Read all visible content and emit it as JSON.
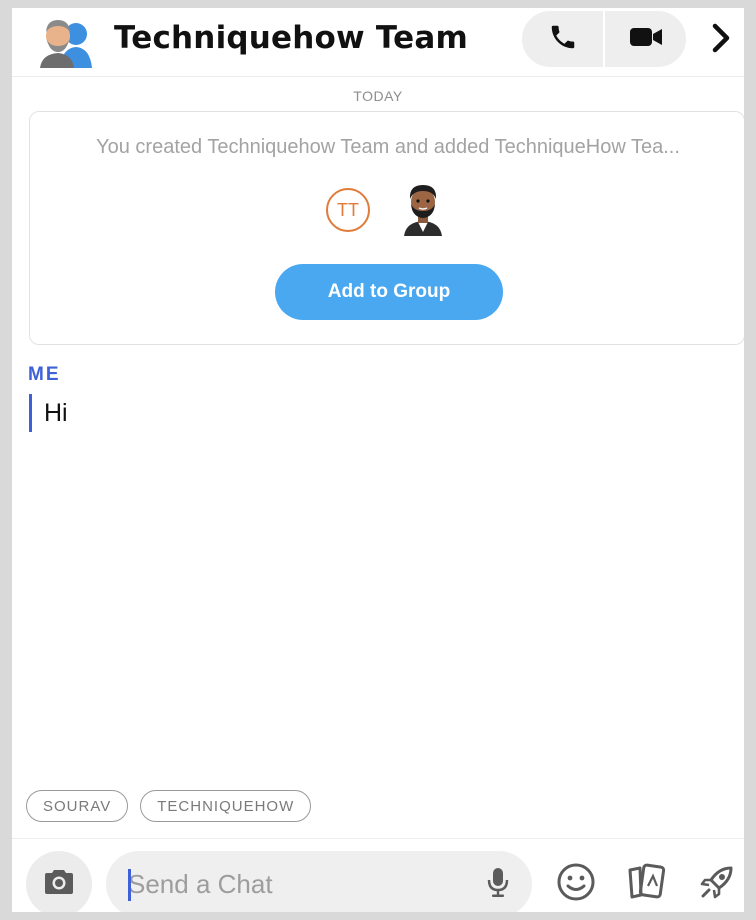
{
  "header": {
    "title": "Techniquehow Team",
    "avatar_icon": "group-avatar-icon",
    "voice_call_icon": "phone-icon",
    "video_call_icon": "video-camera-icon",
    "more_icon": "chevron-right-icon"
  },
  "chat": {
    "day_label": "TODAY",
    "notice": {
      "text": "You created Techniquehow Team and added TechniqueHow Tea...",
      "member_initials": "TT",
      "add_button_label": "Add to Group"
    },
    "messages": [
      {
        "sender": "ME",
        "text": "Hi"
      }
    ]
  },
  "mention_chips": [
    "SOURAV",
    "TECHNIQUEHOW"
  ],
  "composer": {
    "placeholder": "Send a Chat",
    "value": ""
  },
  "colors": {
    "accent_blue": "#4aa8f0",
    "sender_blue": "#3e61d8",
    "initials_orange": "#e07b3a"
  }
}
